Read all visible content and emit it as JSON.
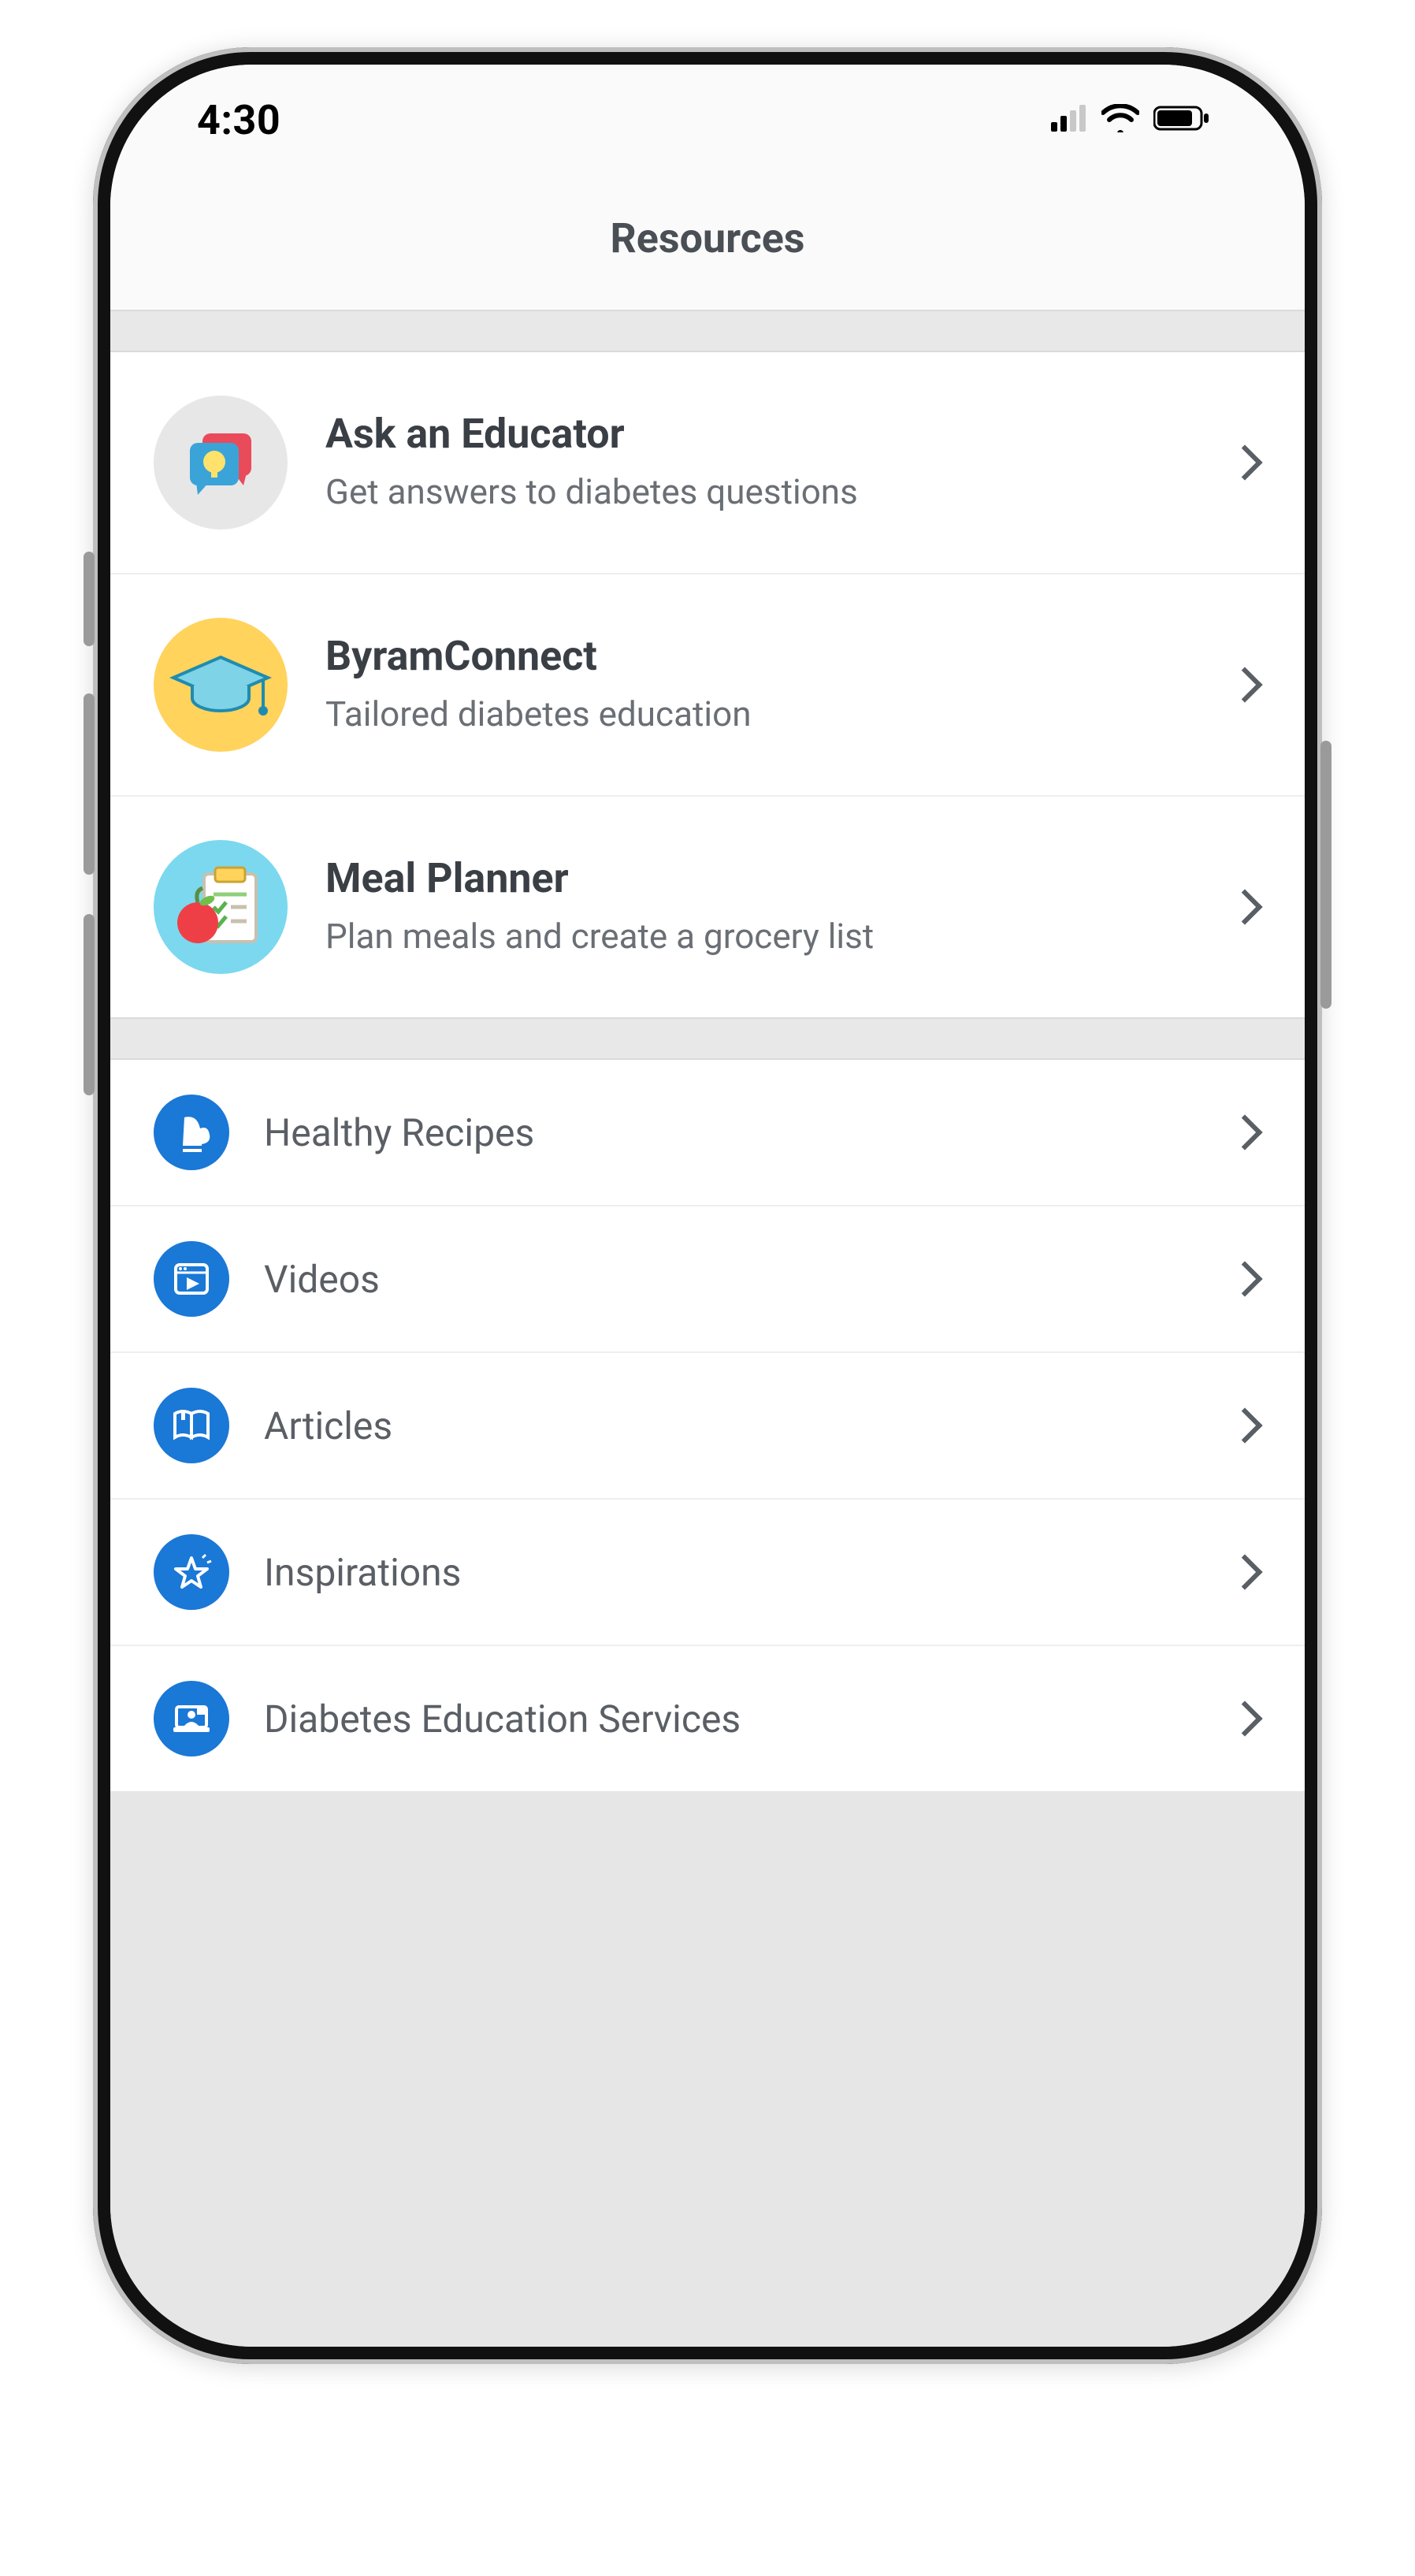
{
  "statusbar": {
    "time": "4:30"
  },
  "header": {
    "title": "Resources"
  },
  "featured": [
    {
      "title": "Ask an Educator",
      "subtitle": "Get answers to diabetes questions",
      "icon": "chat-bulb-icon",
      "bg": "#e7e7e7"
    },
    {
      "title": "ByramConnect",
      "subtitle": "Tailored diabetes education",
      "icon": "graduation-cap-icon",
      "bg": "#ffd35c"
    },
    {
      "title": "Meal Planner",
      "subtitle": "Plan meals and create a grocery list",
      "icon": "meal-planner-icon",
      "bg": "#7bd8ef"
    }
  ],
  "simple": [
    {
      "label": "Healthy Recipes",
      "icon": "oven-mitt-icon"
    },
    {
      "label": "Videos",
      "icon": "video-play-icon"
    },
    {
      "label": "Articles",
      "icon": "book-open-icon"
    },
    {
      "label": "Inspirations",
      "icon": "star-icon"
    },
    {
      "label": "Diabetes Education Services",
      "icon": "laptop-person-icon"
    }
  ]
}
